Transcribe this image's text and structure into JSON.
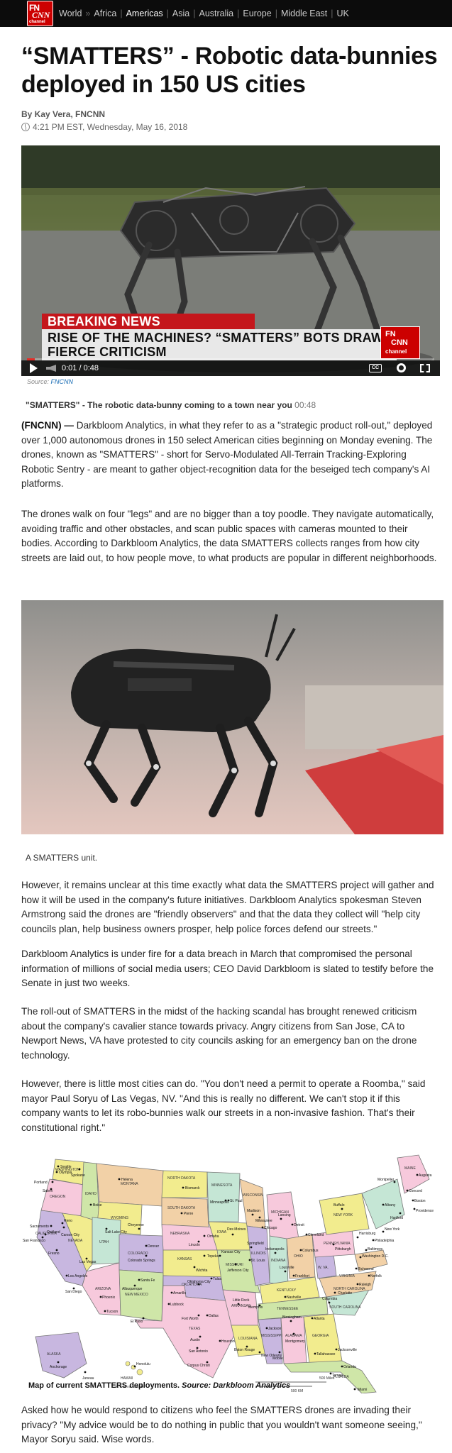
{
  "nav": {
    "logo_lines": [
      "FN",
      "CNN",
      "channel"
    ],
    "links": [
      "World",
      "Africa",
      "Americas",
      "Asia",
      "Australia",
      "Europe",
      "Middle East",
      "UK"
    ],
    "active": "Americas",
    "separators": [
      "»",
      "|",
      "|",
      "|",
      "|",
      "|",
      "|"
    ]
  },
  "article": {
    "headline": "“SMATTERS” - Robotic data-bunnies deployed in 150 US cities",
    "byline": "By Kay Vera, FNCNN",
    "timestamp": "4:21 PM EST, Wednesday, May 16, 2018"
  },
  "video": {
    "breaking": "BREAKING NEWS",
    "lower_third": "RISE OF THE MACHINES? “SMATTERS” BOTS DRAW FIERCE CRITICISM",
    "time": "0:01 / 0:48",
    "progress": 0.02,
    "cc": "CC",
    "source_label": "Source:",
    "source_link": "FNCNN",
    "title_bold": "\"SMATTERS\" - The robotic data-bunny coming to a town near you",
    "title_duration": "00:48"
  },
  "paragraphs": {
    "p1_dateline": "(FNCNN) —",
    "p1": " Darkbloom Analytics, in what they refer to as a \"strategic product roll-out,\" deployed over 1,000 autonomous drones in 150 select American cities beginning on Monday evening. The drones, known as \"SMATTERS\" - short for Servo-Modulated All-Terrain Tracking-Exploring Robotic Sentry - are meant to gather object-recognition data for the beseiged tech company's AI platforms.",
    "p2": "The drones walk on four \"legs\" and are no bigger than a toy poodle. They navigate automatically, avoiding traffic and other obstacles, and scan public spaces with cameras mounted to their bodies. According to Darkbloom Analytics, the data SMATTERS collects ranges from how city streets are laid out, to how people move, to what products are popular in different neighborhoods.",
    "caption": "A SMATTERS unit.",
    "p3": "However, it remains unclear at this time exactly what data the SMATTERS project will gather and how it will be used in the company's future initiatives. Darkbloom Analytics spokesman Steven Armstrong said the drones are \"friendly observers\" and that the data they collect will \"help city councils plan, help business owners prosper, help police forces defend our streets.\"",
    "p4": "Darkbloom Analytics is under fire for a data breach in March that compromised the personal information of millions of social media users; CEO David Darkbloom is slated to testify before the Senate in just two weeks.",
    "p5": "The roll-out of SMATTERS in the midst of the hacking scandal has brought renewed criticism about the company's cavalier stance towards privacy. Angry citizens from San Jose, CA to Newport News, VA have protested to city councils asking for an emergency ban on the drone technology.",
    "p6": "However, there is little most cities can do. \"You don't need a permit to operate a Roomba,\" said mayor Paul Soryu of Las Vegas, NV. \"And this is really no different. We can't stop it if this company wants to let its robo-bunnies walk our streets in a non-invasive fashion. That's their constitutional right.\"",
    "p7": "Asked how he would respond to citizens who feel the SMATTERS drones are invading their privacy? \"My advice would be to do nothing in public that you wouldn't want someone seeing,\" Mayor Soryu said. Wise words."
  },
  "map": {
    "caption_bold": "Map of current SMATTERS deployments.",
    "caption_source": "Source: Darkbloom Analytics",
    "scale_labels": [
      "500 Miles",
      "500 KM"
    ],
    "note": "AK & HI not to scale",
    "labels": {
      "ak": "ALASKA",
      "hi": "HAWAII",
      "wa": "WASHINGTON",
      "or": "OREGON",
      "ca": "CALIFORNIA",
      "nv": "NEVADA",
      "id": "IDAHO",
      "mt": "MONTANA",
      "wy": "WYOMING",
      "ut": "UTAH",
      "az": "ARIZONA",
      "co": "COLORADO",
      "nm": "NEW MEXICO",
      "nd": "NORTH DAKOTA",
      "sd": "SOUTH DAKOTA",
      "ne": "NEBRASKA",
      "ks": "KANSAS",
      "ok": "OKLAHOMA",
      "tx": "TEXAS",
      "mn": "MINNESOTA",
      "ia": "IOWA",
      "mo": "MISSOURI",
      "ar": "ARKANSAS",
      "la": "LOUISIANA",
      "wi": "WISCONSIN",
      "il": "ILLINOIS",
      "mi": "MICHIGAN",
      "in": "INDIANA",
      "oh": "OHIO",
      "ky": "KENTUCKY",
      "tn": "TENNESSEE",
      "ms": "MISSISSIPPI",
      "al": "ALABAMA",
      "ga": "GEORGIA",
      "fl": "FLORIDA",
      "sc": "SOUTH CAROLINA",
      "nc": "NORTH CAROLINA",
      "va": "VIRGINIA",
      "wv": "W. VA.",
      "pa": "PENNSYLVANIA",
      "ny": "NEW YORK",
      "me": "MAINE"
    },
    "cities": [
      "Seattle",
      "Olympia",
      "Spokane",
      "Portland",
      "Salem",
      "Boise",
      "Helena",
      "Bismarck",
      "Pierre",
      "Cheyenne",
      "Salt Lake City",
      "Carson City",
      "Sacramento",
      "Reno",
      "San Francisco",
      "Oakland",
      "Fresno",
      "Las Vegas",
      "Los Angeles",
      "San Diego",
      "Phoenix",
      "Tucson",
      "Albuquerque",
      "Santa Fe",
      "Denver",
      "Colorado Springs",
      "Lincoln",
      "Omaha",
      "Topeka",
      "Wichita",
      "Oklahoma City",
      "Tulsa",
      "Amarillo",
      "Lubbock",
      "El Paso",
      "Dallas",
      "Fort Worth",
      "Austin",
      "San Antonio",
      "Houston",
      "Corpus Christi",
      "Minneapolis",
      "St. Paul",
      "Des Moines",
      "Kansas City",
      "Jefferson City",
      "St. Louis",
      "Springfield",
      "Chicago",
      "Madison",
      "Milwaukee",
      "Lansing",
      "Detroit",
      "Indianapolis",
      "Columbus",
      "Cleveland",
      "Frankfort",
      "Louisville",
      "Nashville",
      "Memphis",
      "Little Rock",
      "Jackson",
      "Baton Rouge",
      "New Orleans",
      "Birmingham",
      "Montgomery",
      "Mobile",
      "Atlanta",
      "Tallahassee",
      "Jacksonville",
      "Orlando",
      "Tampa",
      "Miami",
      "Columbia",
      "Charlotte",
      "Raleigh",
      "Richmond",
      "Norfolk",
      "Washington D.C.",
      "Baltimore",
      "Philadelphia",
      "Harrisburg",
      "Pittsburgh",
      "New York",
      "Albany",
      "Buffalo",
      "Boston",
      "Providence",
      "Hartford",
      "Montpelier",
      "Concord",
      "Augusta",
      "Anchorage",
      "Juneau",
      "Honolulu"
    ]
  }
}
